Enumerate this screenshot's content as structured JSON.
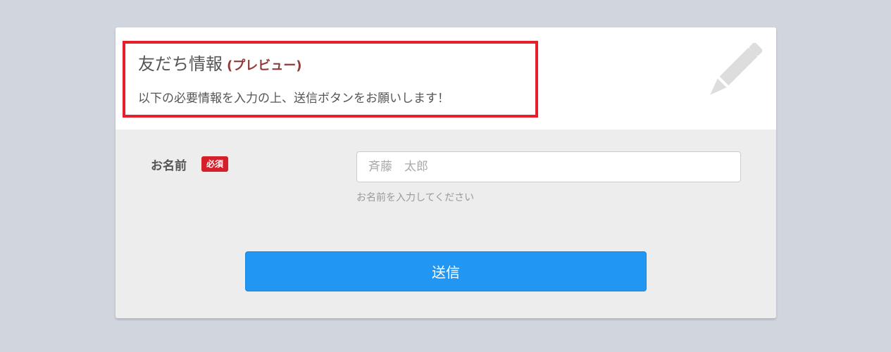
{
  "header": {
    "title": "友だち情報",
    "preview_tag": "(プレビュー)",
    "subtitle": "以下の必要情報を入力の上、送信ボタンをお願いします！",
    "icon": "pencil-icon"
  },
  "form": {
    "name_field": {
      "label": "お名前",
      "required_badge": "必須",
      "placeholder": "斉藤　太郎",
      "value": "",
      "help_text": "お名前を入力してください"
    },
    "submit_label": "送信"
  },
  "colors": {
    "page_background": "#d1d5dd",
    "highlight_border": "#e6202b",
    "preview_tag": "#8e3b3b",
    "required_badge": "#d51f2b",
    "submit_button": "#2196f3",
    "pencil_icon": "#dddddd"
  }
}
